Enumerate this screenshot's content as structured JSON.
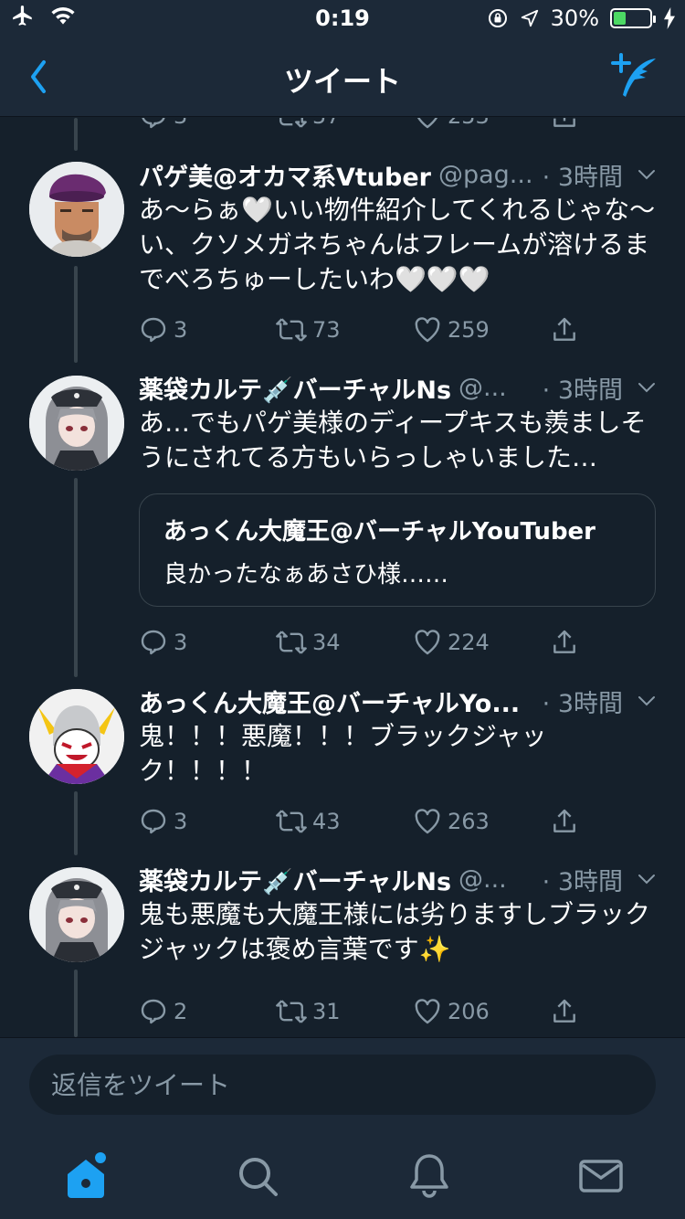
{
  "status_bar": {
    "time": "0:19",
    "battery_percent": "30%",
    "battery_level": 0.3,
    "icons": [
      "airplane-icon",
      "wifi-icon",
      "orientation-lock-icon",
      "location-icon",
      "battery-icon",
      "charging-icon"
    ]
  },
  "nav": {
    "title": "ツイート",
    "back_icon": "chevron-left-icon",
    "compose_icon": "compose-tweet-icon"
  },
  "top_partial_actions": {
    "replies": "3",
    "retweets": "57",
    "likes": "253"
  },
  "tweets": [
    {
      "name": "パゲ美@オカマ系Vtuber",
      "handle": "@pag...",
      "time": "· 3時間",
      "text": "あ〜らぁ🤍いい物件紹介してくれるじゃな〜い、クソメガネちゃんはフレームが溶けるまでべろちゅーしたいわ🤍🤍🤍",
      "replies": "3",
      "retweets": "73",
      "likes": "259"
    },
    {
      "name": "薬袋カルテ💉バーチャルNs",
      "handle": "@...",
      "time": "· 3時間",
      "text": "あ…でもパゲ美様のディープキスも羨ましそうにされてる方もいらっしゃいました…",
      "quote": {
        "author": "あっくん大魔王@バーチャルYouTuber",
        "text": "良かったなぁあさひ様……"
      },
      "replies": "3",
      "retweets": "34",
      "likes": "224"
    },
    {
      "name": "あっくん大魔王@バーチャルYo...",
      "handle": "",
      "time": "· 3時間",
      "text": "鬼！！！悪魔！！！ブラックジャック！！！！",
      "replies": "3",
      "retweets": "43",
      "likes": "263"
    },
    {
      "name": "薬袋カルテ💉バーチャルNs",
      "handle": "@...",
      "time": "· 3時間",
      "text": "鬼も悪魔も大魔王様には劣りますしブラックジャックは褒め言葉です✨",
      "replies": "2",
      "retweets": "31",
      "likes": "206"
    }
  ],
  "reply_bar": {
    "placeholder": "返信をツイート"
  },
  "tab_bar": {
    "items": [
      "home-icon",
      "search-icon",
      "notifications-icon",
      "messages-icon"
    ],
    "active": "home-icon"
  },
  "colors": {
    "background": "#15202b",
    "bar": "#1c2938",
    "accent": "#1da1f2",
    "secondary_text": "#8899a6"
  }
}
